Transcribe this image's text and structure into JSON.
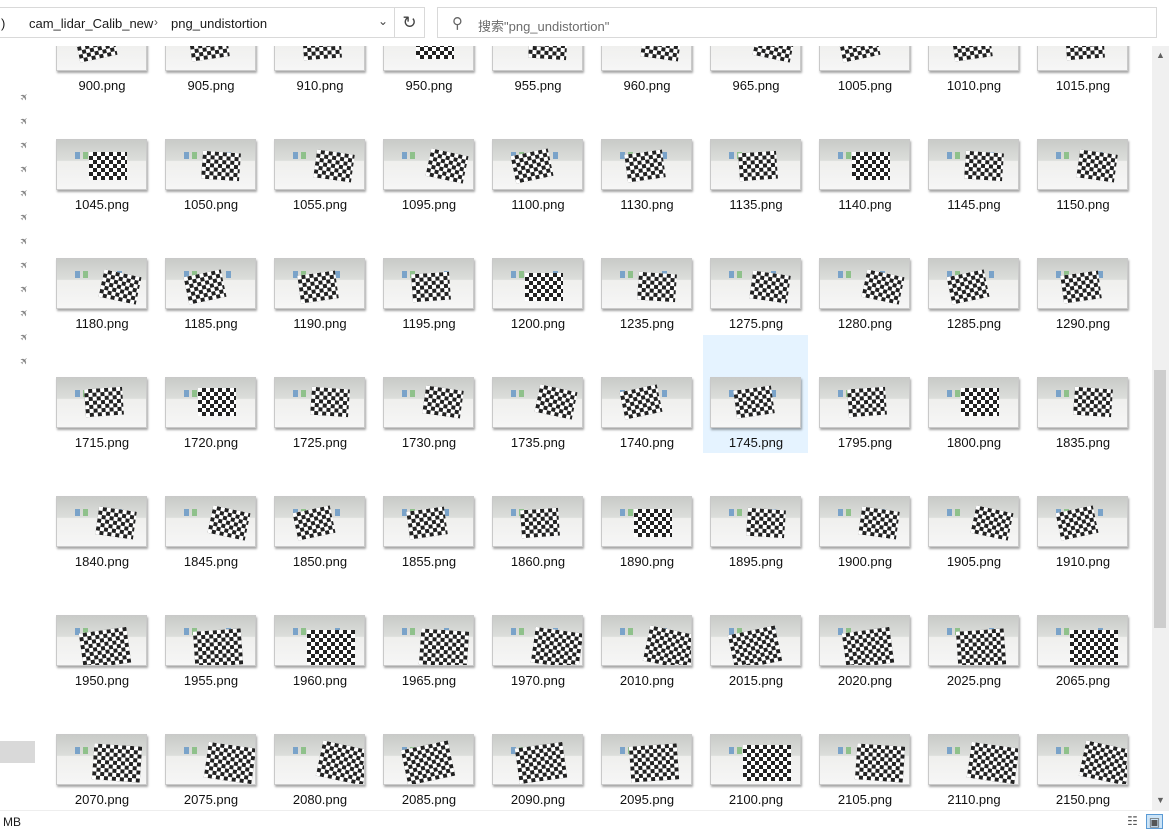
{
  "address": {
    "prev_crumb_sep": ")",
    "crumbs": [
      "cam_lidar_Calib_new",
      "png_undistortion"
    ],
    "separator": "›",
    "dropdown_icon": "chevron-down-icon"
  },
  "refresh_icon": "↻",
  "search": {
    "placeholder": "搜索\"png_undistortion\"",
    "icon": "search-icon"
  },
  "rows": [
    [
      "900.png",
      "905.png",
      "910.png",
      "950.png",
      "955.png",
      "960.png",
      "965.png",
      "1005.png",
      "1010.png",
      "1015.png"
    ],
    [
      "1045.png",
      "1050.png",
      "1055.png",
      "1095.png",
      "1100.png",
      "1130.png",
      "1135.png",
      "1140.png",
      "1145.png",
      "1150.png"
    ],
    [
      "1180.png",
      "1185.png",
      "1190.png",
      "1195.png",
      "1200.png",
      "1235.png",
      "1275.png",
      "1280.png",
      "1285.png",
      "1290.png"
    ],
    [
      "1715.png",
      "1720.png",
      "1725.png",
      "1730.png",
      "1735.png",
      "1740.png",
      "1745.png",
      "1795.png",
      "1800.png",
      "1835.png"
    ],
    [
      "1840.png",
      "1845.png",
      "1850.png",
      "1855.png",
      "1860.png",
      "1890.png",
      "1895.png",
      "1900.png",
      "1905.png",
      "1910.png"
    ],
    [
      "1950.png",
      "1955.png",
      "1960.png",
      "1965.png",
      "1970.png",
      "2010.png",
      "2015.png",
      "2020.png",
      "2025.png",
      "2065.png"
    ],
    [
      "2070.png",
      "2075.png",
      "2080.png",
      "2085.png",
      "2090.png",
      "2095.png",
      "2100.png",
      "2105.png",
      "2110.png",
      "2150.png"
    ]
  ],
  "selected_file": "1745.png",
  "status": {
    "text": "MB"
  },
  "colors": {
    "selection": "#e5f3ff",
    "accent": "#0078d7"
  }
}
